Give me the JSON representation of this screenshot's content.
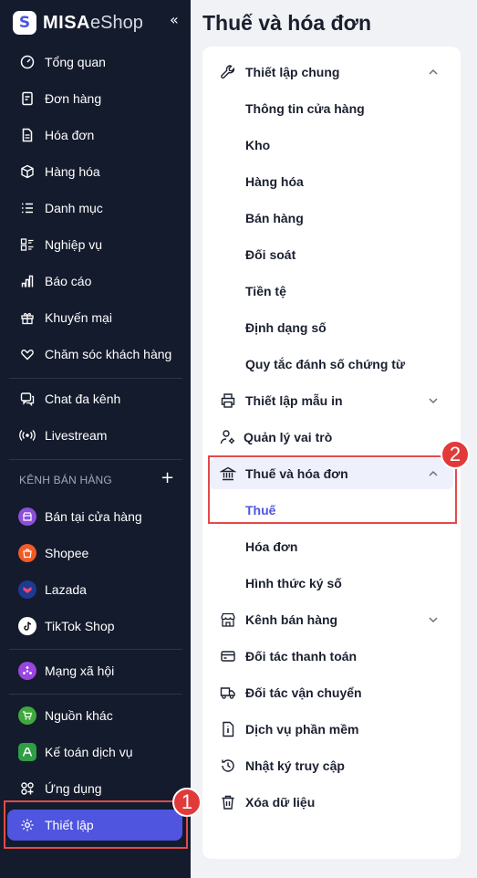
{
  "brand": {
    "logo_letter": "S",
    "name_bold": "MISA",
    "name_regular": "eShop",
    "collapse_glyph": "«"
  },
  "sidebar": {
    "items": [
      {
        "label": "Tổng quan",
        "icon": "home-icon"
      },
      {
        "label": "Đơn hàng",
        "icon": "order-icon"
      },
      {
        "label": "Hóa đơn",
        "icon": "invoice-icon"
      },
      {
        "label": "Hàng hóa",
        "icon": "box-icon"
      },
      {
        "label": "Danh mục",
        "icon": "list-icon"
      },
      {
        "label": "Nghiệp vụ",
        "icon": "operations-icon"
      },
      {
        "label": "Báo cáo",
        "icon": "chart-icon"
      },
      {
        "label": "Khuyến mại",
        "icon": "gift-icon"
      },
      {
        "label": "Chăm sóc khách hàng",
        "icon": "heart-hand-icon"
      },
      {
        "label": "Chat đa kênh",
        "icon": "chat-icon"
      },
      {
        "label": "Livestream",
        "icon": "livestream-icon"
      }
    ],
    "channels_title": "KÊNH BÁN HÀNG",
    "channels_add": "+",
    "channels": [
      {
        "label": "Bán tại cửa hàng",
        "color": "#8b4fd8",
        "icon": "store-icon"
      },
      {
        "label": "Shopee",
        "color": "#f25a26",
        "icon": "shopee-icon"
      },
      {
        "label": "Lazada",
        "color": "#1d3a8f",
        "icon": "lazada-icon"
      },
      {
        "label": "TikTok Shop",
        "color": "#ffffff",
        "icon": "tiktok-icon"
      }
    ],
    "bottom_items": [
      {
        "label": "Mạng xã hội",
        "color": "#9a45e0",
        "icon": "social-icon"
      },
      {
        "label": "Nguồn khác",
        "color": "#3fa83f",
        "icon": "cart-icon"
      },
      {
        "label": "Kế toán dịch vụ",
        "color": "#2f9e44",
        "icon": "accounting-icon"
      },
      {
        "label": "Ứng dụng",
        "icon": "apps-icon"
      },
      {
        "label": "Thiết lập",
        "icon": "gear-icon",
        "active": true
      }
    ]
  },
  "main": {
    "title": "Thuế và hóa đơn",
    "menu": {
      "general": {
        "label": "Thiết lập chung",
        "icon": "wrench-icon"
      },
      "general_subs": [
        "Thông tin cửa hàng",
        "Kho",
        "Hàng hóa",
        "Bán hàng",
        "Đối soát",
        "Tiền tệ",
        "Định dạng số",
        "Quy tắc đánh số chứng từ"
      ],
      "print": {
        "label": "Thiết lập mẫu in",
        "icon": "printer-icon"
      },
      "roles": {
        "label": "Quản lý vai trò",
        "icon": "user-gear-icon"
      },
      "tax": {
        "label": "Thuế và hóa đơn",
        "icon": "bank-icon"
      },
      "tax_subs": [
        "Thuế",
        "Hóa đơn",
        "Hình thức ký số"
      ],
      "channels": {
        "label": "Kênh bán hàng",
        "icon": "storefront-icon"
      },
      "payment": {
        "label": "Đối tác thanh toán",
        "icon": "card-icon"
      },
      "shipping": {
        "label": "Đối tác vận chuyển",
        "icon": "truck-icon"
      },
      "software": {
        "label": "Dịch vụ phần mềm",
        "icon": "info-doc-icon"
      },
      "log": {
        "label": "Nhật ký truy cập",
        "icon": "history-icon"
      },
      "delete": {
        "label": "Xóa dữ liệu",
        "icon": "trash-icon"
      }
    }
  },
  "callouts": {
    "one": "1",
    "two": "2"
  },
  "colors": {
    "accent": "#4f55de",
    "sidebar_bg": "#141b2d",
    "callout_red": "#e24a4a"
  }
}
